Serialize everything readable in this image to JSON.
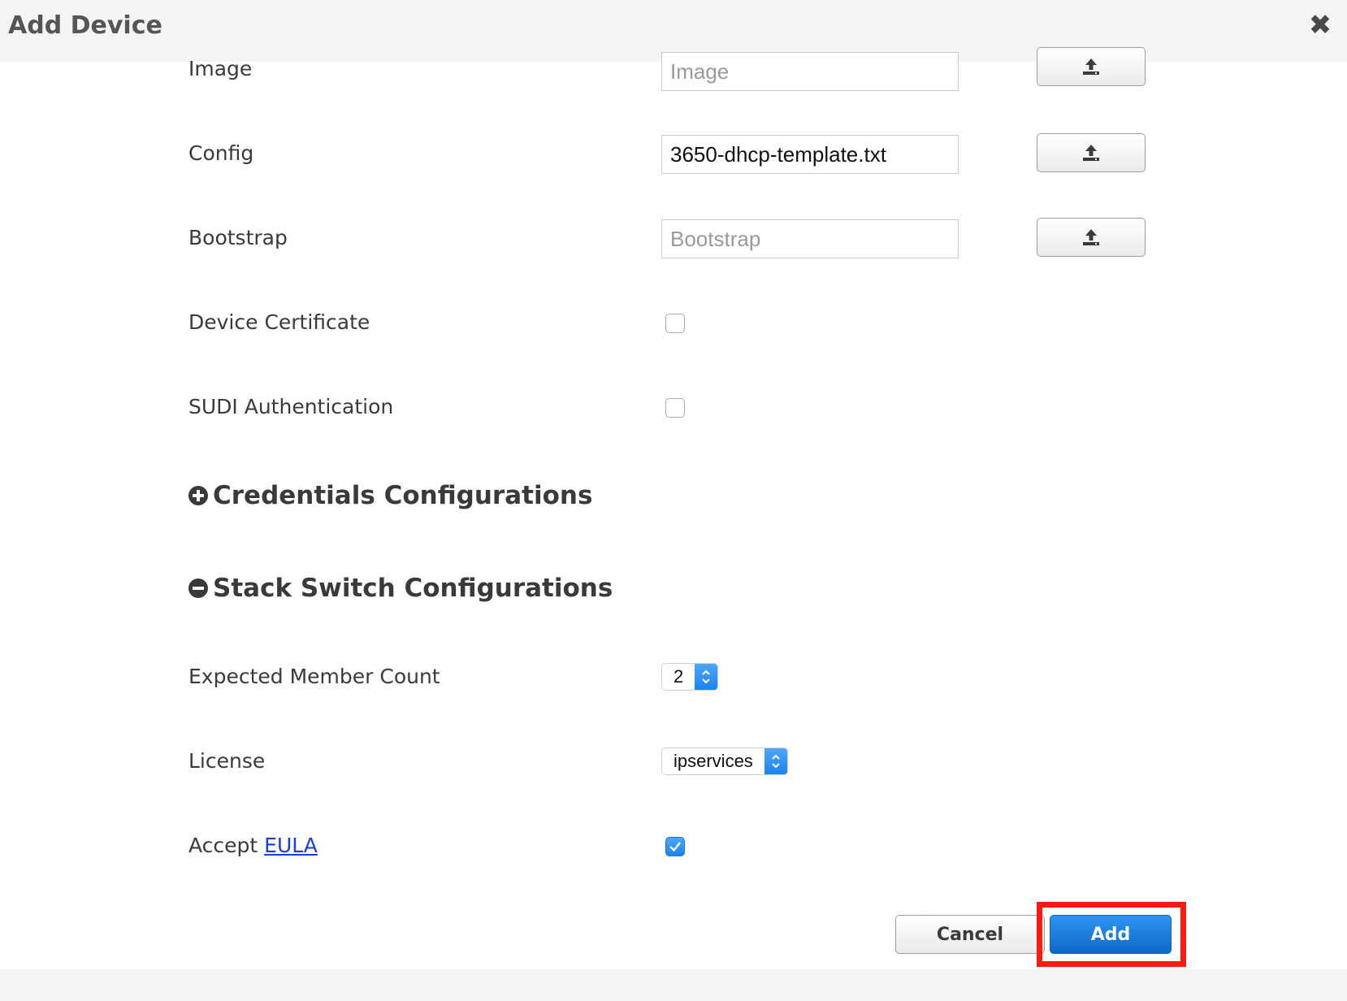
{
  "dialog": {
    "title": "Add Device",
    "close_icon": "close-icon"
  },
  "form": {
    "image": {
      "label": "Image",
      "value": "",
      "placeholder": "Image"
    },
    "config": {
      "label": "Config",
      "value": "3650-dhcp-template.txt",
      "placeholder": ""
    },
    "bootstrap": {
      "label": "Bootstrap",
      "value": "",
      "placeholder": "Bootstrap"
    },
    "device_certificate": {
      "label": "Device Certificate",
      "checked": false
    },
    "sudi_authentication": {
      "label": "SUDI Authentication",
      "checked": false
    }
  },
  "sections": {
    "credentials": {
      "label": "Credentials Configurations",
      "icon": "plus-circle-icon",
      "expanded": false
    },
    "stack_switch": {
      "label": "Stack Switch Configurations",
      "icon": "minus-circle-icon",
      "expanded": true
    }
  },
  "stack": {
    "expected_member_count": {
      "label": "Expected Member Count",
      "value": "2"
    },
    "license": {
      "label": "License",
      "value": "ipservices"
    },
    "accept_eula": {
      "label": "Accept",
      "link_text": "EULA",
      "checked": true
    }
  },
  "footer": {
    "cancel_label": "Cancel",
    "add_label": "Add"
  },
  "colors": {
    "primary": "#1b83f0",
    "highlight": "#ff1a0f"
  }
}
